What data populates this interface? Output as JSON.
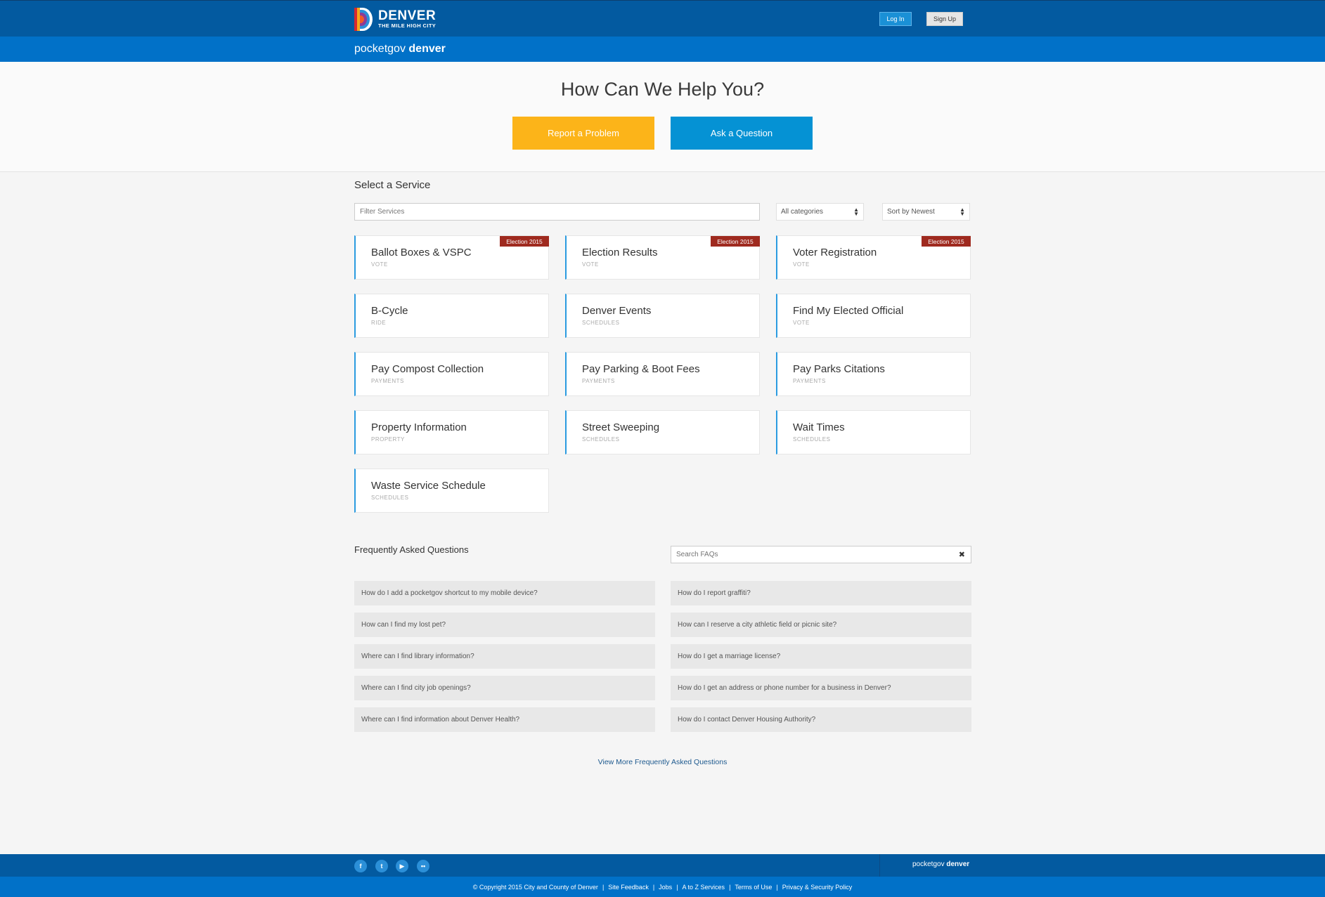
{
  "header": {
    "logo_title": "DENVER",
    "logo_subtitle": "THE MILE HIGH CITY",
    "login_label": "Log In",
    "signup_label": "Sign Up",
    "brand_prefix": "pocketgov ",
    "brand_bold": "denver"
  },
  "hero": {
    "title": "How Can We Help You?",
    "report_label": "Report a Problem",
    "ask_label": "Ask a Question"
  },
  "services": {
    "title": "Select a Service",
    "filter_placeholder": "Filter Services",
    "category_select": "All categories",
    "sort_select": "Sort by Newest",
    "items": [
      {
        "name": "Ballot Boxes & VSPC",
        "category": "VOTE",
        "tag": "Election 2015"
      },
      {
        "name": "Election Results",
        "category": "VOTE",
        "tag": "Election 2015"
      },
      {
        "name": "Voter Registration",
        "category": "VOTE",
        "tag": "Election 2015"
      },
      {
        "name": "B-Cycle",
        "category": "RIDE",
        "tag": ""
      },
      {
        "name": "Denver Events",
        "category": "SCHEDULES",
        "tag": ""
      },
      {
        "name": "Find My Elected Official",
        "category": "VOTE",
        "tag": ""
      },
      {
        "name": "Pay Compost Collection",
        "category": "PAYMENTS",
        "tag": ""
      },
      {
        "name": "Pay Parking & Boot Fees",
        "category": "PAYMENTS",
        "tag": ""
      },
      {
        "name": "Pay Parks Citations",
        "category": "PAYMENTS",
        "tag": ""
      },
      {
        "name": "Property Information",
        "category": "PROPERTY",
        "tag": ""
      },
      {
        "name": "Street Sweeping",
        "category": "SCHEDULES",
        "tag": ""
      },
      {
        "name": "Wait Times",
        "category": "SCHEDULES",
        "tag": ""
      },
      {
        "name": "Waste Service Schedule",
        "category": "SCHEDULES",
        "tag": ""
      }
    ]
  },
  "faq": {
    "title": "Frequently Asked Questions",
    "search_placeholder": "Search FAQs",
    "clear_icon": "close-icon",
    "left": [
      "How do I add a pocketgov shortcut to my mobile device?",
      "How can I find my lost pet?",
      "Where can I find library information?",
      "Where can I find city job openings?",
      "Where can I find information about Denver Health?"
    ],
    "right": [
      "How do I report graffiti?",
      "How can I reserve a city athletic field or picnic site?",
      "How do I get a marriage license?",
      "How do I get an address or phone number for a business in Denver?",
      "How do I contact Denver Housing Authority?"
    ],
    "more_label": "View More Frequently Asked Questions"
  },
  "footer": {
    "social": [
      {
        "icon": "facebook-icon",
        "glyph": "f"
      },
      {
        "icon": "twitter-icon",
        "glyph": "t"
      },
      {
        "icon": "youtube-icon",
        "glyph": "▶"
      },
      {
        "icon": "flickr-icon",
        "glyph": "••"
      }
    ],
    "brand_prefix": "pocketgov ",
    "brand_bold": "denver",
    "copyright": "© Copyright 2015 City and County of Denver",
    "links": [
      "Site Feedback",
      "Jobs",
      "A to Z Services",
      "Terms of Use",
      "Privacy & Security Policy"
    ]
  },
  "colors": {
    "header_dark": "#035aa0",
    "header_light": "#0171c8",
    "report": "#fcb419",
    "ask": "#0592d4",
    "tag": "#9f2a1f",
    "card_accent": "#2a9be0"
  }
}
